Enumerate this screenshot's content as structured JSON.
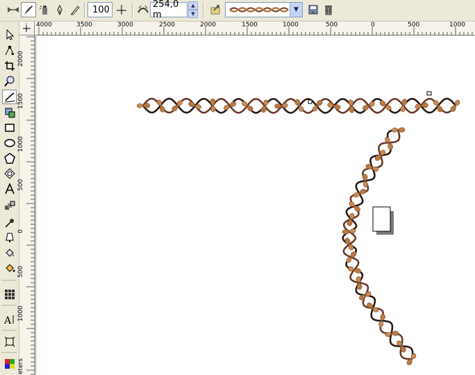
{
  "property_bar": {
    "tools": [
      {
        "name": "preset-brush-icon"
      },
      {
        "name": "artistic-brush-icon"
      },
      {
        "name": "sprayer-icon"
      },
      {
        "name": "calligraphic-icon"
      },
      {
        "name": "pressure-icon"
      }
    ],
    "smoothing_value": "100",
    "width_value": "254,0 m",
    "selected_stroke": "vine-stroke"
  },
  "ruler": {
    "horizontal_labels": [
      "4000",
      "3500",
      "3000",
      "2500",
      "2000",
      "1500",
      "1000",
      "500",
      "0",
      "500",
      "1000"
    ],
    "vertical_labels": [
      "2000",
      "1500",
      "1000",
      "500",
      "0",
      "500",
      "1000"
    ],
    "unit_label": "eters"
  },
  "colors": {
    "vine_leaf": "#b97a45",
    "vine_stem": "#2a1a14",
    "vine_stem2": "#6a3a2a"
  }
}
